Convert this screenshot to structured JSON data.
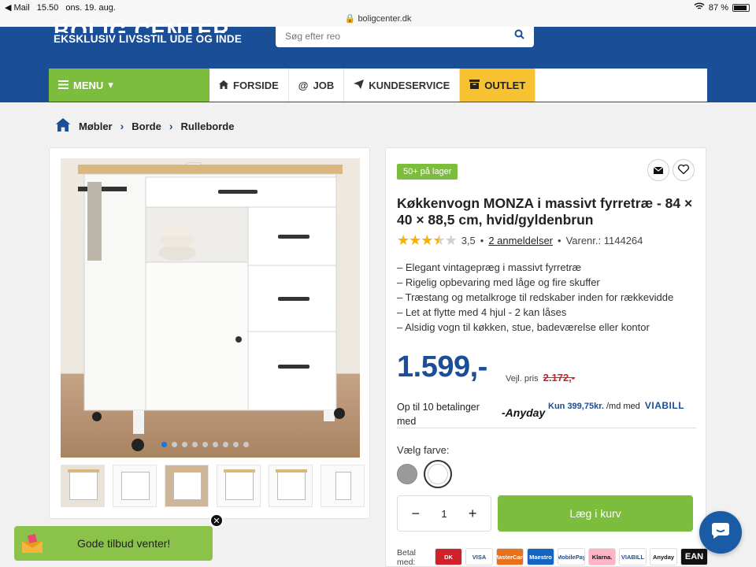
{
  "status_bar": {
    "back_app": "◀ Mail",
    "time": "15.50",
    "date": "ons. 19. aug.",
    "url": "boligcenter.dk",
    "battery": "87 %"
  },
  "header": {
    "brand": "BOLIG CENTER",
    "tagline": "EKSKLUSIV LIVSSTIL UDE OG INDE",
    "search_placeholder": "Søg efter reo"
  },
  "nav": {
    "menu_label": "MENU",
    "items": [
      {
        "label": "FORSIDE",
        "icon": "home-icon"
      },
      {
        "label": "JOB",
        "icon": "at-icon"
      },
      {
        "label": "KUNDESERVICE",
        "icon": "send-icon"
      },
      {
        "label": "OUTLET",
        "icon": "box-icon"
      }
    ]
  },
  "breadcrumb": [
    "Møbler",
    "Borde",
    "Rulleborde"
  ],
  "gallery": {
    "dots_total": 9,
    "active_dot": 1,
    "thumbnails": 6
  },
  "product": {
    "stock": "50+ på lager",
    "title": "Køkkenvogn MONZA i massivt fyrretræ - 84 × 40 × 88,5 cm, hvid/gyldenbrun",
    "rating_value": 3.5,
    "rating": "3,5",
    "reviews": "2 anmeldelser",
    "sku": "Varenr.: 1144264",
    "bullets": [
      "Elegant vintagepræg i massivt fyrretræ",
      "Rigelig opbevaring med låge og fire skuffer",
      "Træstang og metalkroge til redskaber inden for rækkevidde",
      "Let at flytte med 4 hjul - 2 kan låses",
      "Alsidig vogn til køkken, stue, badeværelse eller kontor"
    ],
    "price": "1.599,-",
    "vejl_label": "Vejl. pris",
    "old_price": "2.172,-",
    "installments": "Op til 10 betalinger med",
    "anyday": "Anyday",
    "viabill_amount": "Kun 399,75kr.",
    "viabill_text": "/md med",
    "viabill_logo": "VIABILL",
    "color_label": "Vælg farve:",
    "colors": [
      "#9a9a9a",
      "#ffffff"
    ],
    "quantity": "1",
    "minus": "−",
    "plus": "+",
    "add_to_cart": "Læg i kurv",
    "pay_label": "Betal med:",
    "pay_methods": [
      "DK",
      "VISA",
      "MasterCard",
      "Maestro",
      "MobilePay",
      "Klarna.",
      "VIABILL",
      "Anyday",
      "EAN"
    ]
  },
  "toast": {
    "text": "Gode tilbud venter!",
    "close": "✕"
  },
  "colors": {
    "brand_blue": "#1a4e97",
    "green": "#7dbd3d",
    "outlet_yellow": "#f6c232",
    "price_blue": "#1a4e97",
    "old_price_red": "#d0202a"
  }
}
